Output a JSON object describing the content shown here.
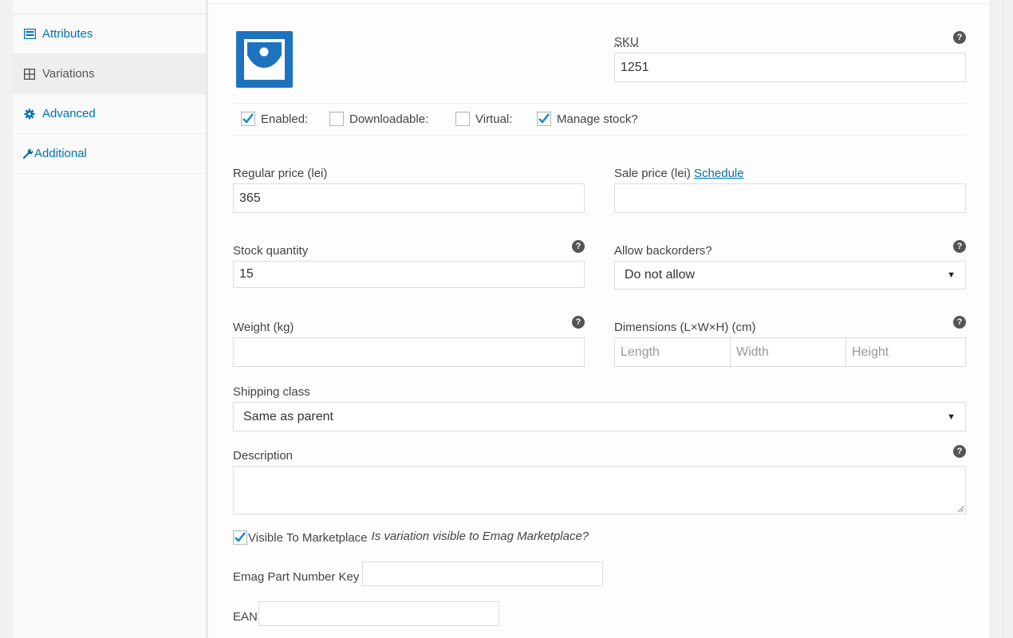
{
  "sidebar": {
    "items": [
      {
        "label": "Attributes",
        "icon": "list-icon"
      },
      {
        "label": "Variations",
        "icon": "grid-icon"
      },
      {
        "label": "Advanced",
        "icon": "gear-icon"
      },
      {
        "label": "Additional",
        "icon": "wrench-icon"
      }
    ],
    "active": "Variations"
  },
  "variation": {
    "sku_label": "SKU",
    "sku_value": "1251",
    "options": {
      "enabled": {
        "label": "Enabled:",
        "checked": true
      },
      "downloadable": {
        "label": "Downloadable:",
        "checked": false
      },
      "virtual": {
        "label": "Virtual:",
        "checked": false
      },
      "manage_stock": {
        "label": "Manage stock?",
        "checked": true
      }
    },
    "regular_price_label": "Regular price (lei)",
    "regular_price_value": "365",
    "sale_price_label": "Sale price (lei)",
    "sale_schedule_link": "Schedule",
    "sale_price_value": "",
    "stock_qty_label": "Stock quantity",
    "stock_qty_value": "15",
    "backorders_label": "Allow backorders?",
    "backorders_value": "Do not allow",
    "weight_label": "Weight (kg)",
    "weight_value": "",
    "dimensions_label": "Dimensions (L×W×H) (cm)",
    "length_placeholder": "Length",
    "width_placeholder": "Width",
    "height_placeholder": "Height",
    "shipping_class_label": "Shipping class",
    "shipping_class_value": "Same as parent",
    "description_label": "Description",
    "description_value": "",
    "visible_marketplace_label": "Visible To Marketplace",
    "visible_marketplace_checked": true,
    "visible_marketplace_hint": "Is variation visible to Emag Marketplace?",
    "emag_part_label": "Emag Part Number Key",
    "emag_part_value": "",
    "ean_label": "EAN",
    "ean_value": ""
  },
  "colors": {
    "accent": "#0073aa",
    "image_bg": "#1e73be",
    "check": "#1e8cbe"
  }
}
